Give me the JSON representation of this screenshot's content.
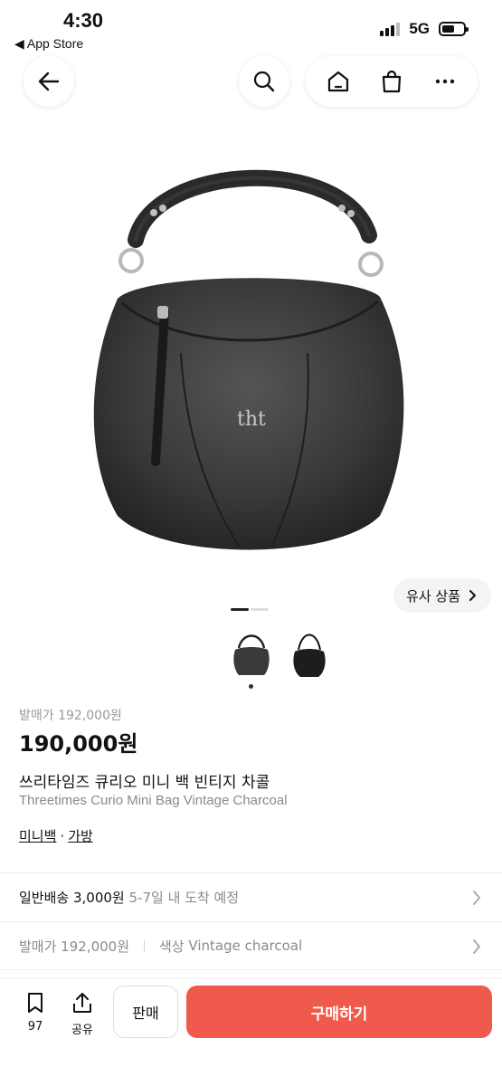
{
  "status_bar": {
    "time": "4:30",
    "back_app": "◀ App Store",
    "network": "5G"
  },
  "similar_button": {
    "label": "유사 상품",
    "icon": "chevron-right-icon"
  },
  "product": {
    "original_price": "발매가 192,000원",
    "price": "190,000원",
    "title_ko": "쓰리타임즈 큐리오 미니 백 빈티지 차콜",
    "title_en": "Threetimes Curio Mini Bag Vintage Charcoal",
    "logo_text": "tht",
    "tags": [
      "미니백",
      "가방"
    ],
    "tag_separator": "·"
  },
  "rows": {
    "shipping_label": "일반배송 3,000원",
    "shipping_eta": "5-7일 내 도착 예정",
    "release_price": "발매가 192,000원",
    "color_label": "색상",
    "color_value": "Vintage charcoal"
  },
  "bottom_bar": {
    "bookmark_count": "97",
    "share_label": "공유",
    "sell_label": "판매",
    "buy_label": "구매하기"
  },
  "colors": {
    "buy_button": "#ef5a4c",
    "bag": "#3a3a3c"
  }
}
